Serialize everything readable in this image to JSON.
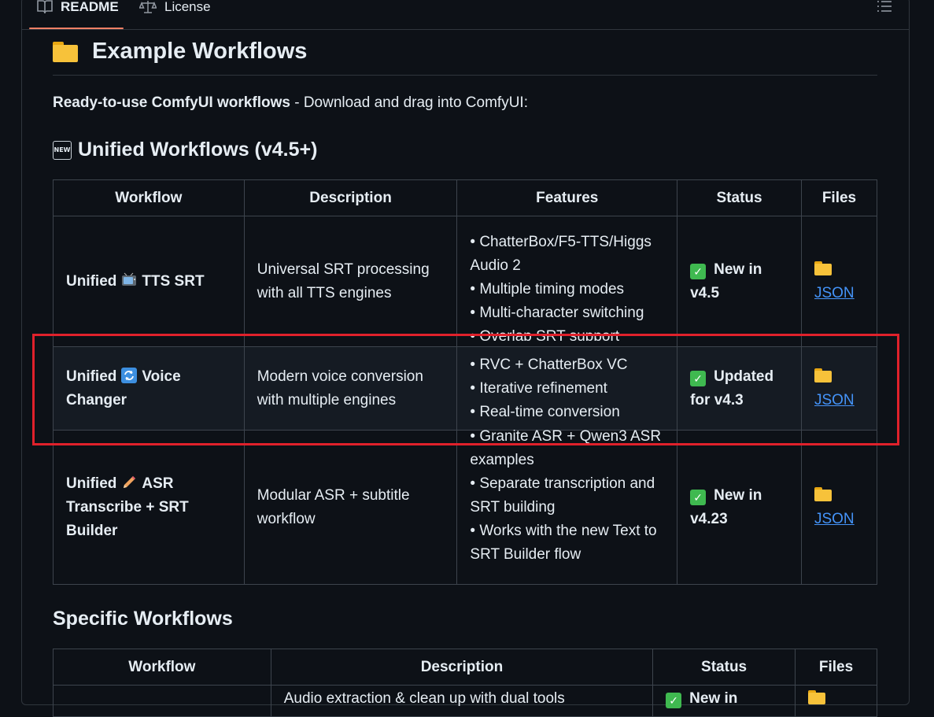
{
  "tabs": [
    {
      "label": "README",
      "icon": "book-icon",
      "active": true
    },
    {
      "label": "License",
      "icon": "scale-icon",
      "active": false
    }
  ],
  "outline_icon": "list-icon",
  "heading": {
    "text": "Example Workflows",
    "icon": "folder-icon"
  },
  "intro": {
    "bold": "Ready-to-use ComfyUI workflows",
    "rest": " - Download and drag into ComfyUI:"
  },
  "unified": {
    "title": "Unified Workflows (v4.5+)",
    "badge": "NEW",
    "columns": [
      "Workflow",
      "Description",
      "Features",
      "Status",
      "Files"
    ],
    "rows": [
      {
        "workflow_a": "Unified",
        "emoji": "tv-icon",
        "workflow_b": "TTS SRT",
        "description": "Universal SRT processing with all TTS engines",
        "features": [
          "• ChatterBox/F5-TTS/Higgs Audio 2",
          "• Multiple timing modes",
          "• Multi-character switching",
          "• Overlap SRT support"
        ],
        "status": "New in v4.5",
        "file": "JSON"
      },
      {
        "workflow_a": "Unified",
        "emoji": "cycle-icon",
        "workflow_b": "Voice Changer",
        "description": "Modern voice conversion with multiple engines",
        "features": [
          "• RVC + ChatterBox VC",
          "• Iterative refinement",
          "• Real-time conversion"
        ],
        "status": "Updated for v4.3",
        "file": "JSON"
      },
      {
        "workflow_a": "Unified",
        "emoji": "pencil-icon",
        "workflow_b": "ASR Transcribe + SRT Builder",
        "description": "Modular ASR + subtitle workflow",
        "features": [
          "• Granite ASR + Qwen3 ASR examples",
          "• Separate transcription and SRT building",
          "• Works with the new Text to SRT Builder flow"
        ],
        "status": "New in v4.23",
        "file": "JSON"
      }
    ]
  },
  "specific": {
    "title": "Specific Workflows",
    "columns": [
      "Workflow",
      "Description",
      "Status",
      "Files"
    ],
    "peek_description": "Audio extraction & clean up with dual tools",
    "peek_status": "New in"
  }
}
